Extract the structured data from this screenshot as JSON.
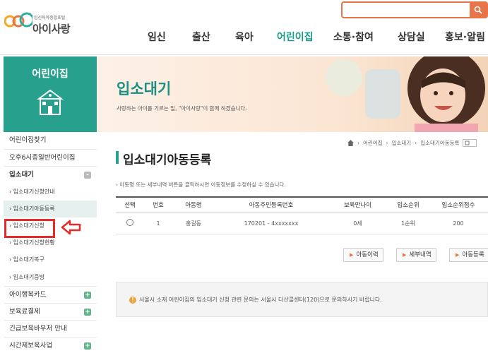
{
  "logo": {
    "subtitle": "임신육아종합포털",
    "name": "아이사랑"
  },
  "gnb": [
    "임신",
    "출산",
    "육아",
    "어린이집",
    "소통·참여",
    "상담실",
    "홍보·알림"
  ],
  "lnb": {
    "title": "어린이집",
    "items": [
      {
        "label": "어린이집찾기"
      },
      {
        "label": "오후6시종일반어린이집"
      },
      {
        "label": "입소대기",
        "toggle": "-"
      },
      {
        "label": "› 입소대기신청안내"
      },
      {
        "label": "› 입소대기아동등록"
      },
      {
        "label": "› 입소대기신청"
      },
      {
        "label": "› 입소대기신청현황"
      },
      {
        "label": "› 입소대기복구"
      },
      {
        "label": "› 입소대기증빙"
      },
      {
        "label": "아이행복카드",
        "toggle": "+"
      },
      {
        "label": "보육료결제",
        "toggle": "+"
      },
      {
        "label": "긴급보육바우처 안내"
      },
      {
        "label": "시간제보육사업",
        "toggle": "+"
      }
    ]
  },
  "banner": {
    "title": "입소대기",
    "subtitle": "사랑하는 아이를 기르는 일, \"아이사랑\"이 함께 하겠습니다."
  },
  "breadcrumb": [
    "어린이집",
    "입소대기",
    "입소대기아동등록"
  ],
  "page": {
    "title": "입소대기아동등록",
    "notice": "› 아동명 또는 세부내역 버튼을 클릭하시면 아동정보를 수정하실 수 있습니다."
  },
  "table": {
    "headers": [
      "선택",
      "번호",
      "아동명",
      "아동주민등록번호",
      "보육만나이",
      "입소순위",
      "입소순위점수"
    ],
    "rows": [
      [
        "",
        "1",
        "홍길동",
        "170201 - 4xxxxxxx",
        "0세",
        "1순위",
        "200"
      ]
    ]
  },
  "buttons": {
    "history": "아동이력",
    "detail": "세부내역",
    "register": "아동등록"
  },
  "info": "서울시 소재 어린이집의 입소대기 신청 관련 문의는 서울시 다산콜센터(120)으로 문의하시기 바랍니다.",
  "colors": {
    "accent": "#27a08d",
    "orange": "#e8744a",
    "highlight": "#e52a2a"
  }
}
